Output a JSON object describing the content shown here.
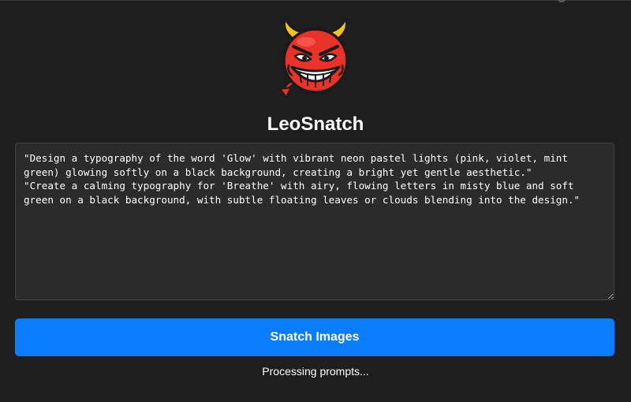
{
  "app": {
    "title": "LeoSnatch",
    "logo_icon": "devil-emoji-icon"
  },
  "prompt": {
    "value": "\"Design a typography of the word 'Glow' with vibrant neon pastel lights (pink, violet, mint green) glowing softly on a black background, creating a bright yet gentle aesthetic.\"\n\"Create a calming typography for 'Breathe' with airy, flowing letters in misty blue and soft green on a black background, with subtle floating leaves or clouds blending into the design.\""
  },
  "actions": {
    "snatch_label": "Snatch Images"
  },
  "status": {
    "text": "Processing prompts..."
  },
  "colors": {
    "background": "#1e1e1e",
    "accent": "#0a7cff",
    "devil_red": "#e8322a",
    "horn_yellow": "#f5c21b"
  }
}
